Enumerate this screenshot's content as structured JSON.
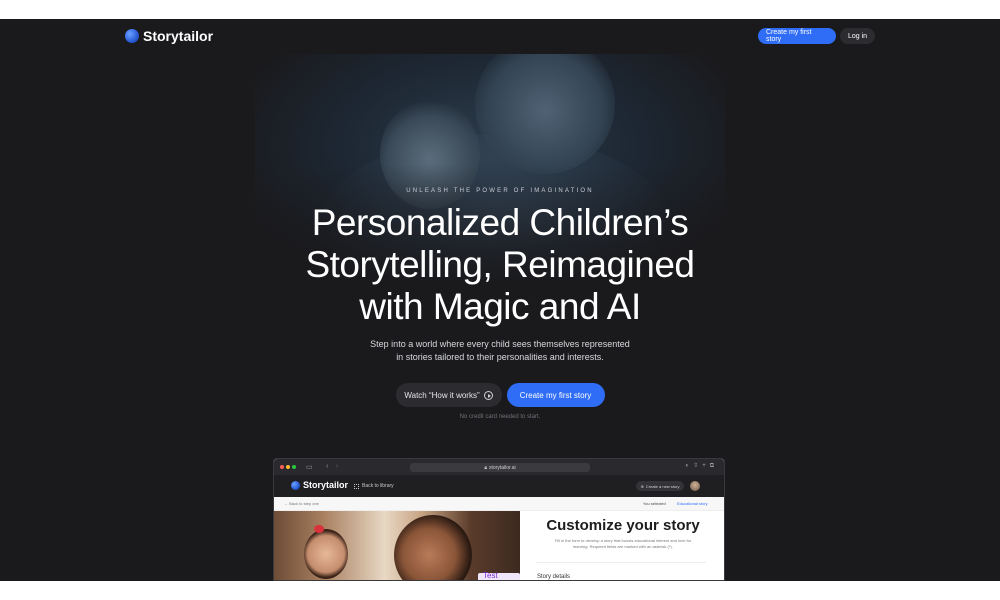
{
  "brand": {
    "name": "Storytailor"
  },
  "nav": {
    "cta": "Create my first story",
    "login": "Log in"
  },
  "hero": {
    "eyebrow": "UNLEASH THE POWER OF IMAGINATION",
    "headline_lines": [
      "Personalized Children’s",
      "Storytelling, Reimagined",
      "with Magic and AI"
    ],
    "subtitle_lines": [
      "Step into a world where every child sees themselves represented",
      "in stories tailored to their personalities and interests."
    ],
    "watch_label": "Watch “How it works”",
    "create_label": "Create my first story",
    "note": "No credit card needed to start."
  },
  "preview": {
    "url": "storytailor.ai",
    "app_name": "Storytailor",
    "back_to_library": "Back to library",
    "create_new": "Create a new story",
    "back_to_step": "← Back to step one",
    "you_selected": "You selected",
    "selected_type": "Educational story",
    "test_mode": "Test Mode",
    "form_title": "Customize your story",
    "form_desc": "Fill in the form to develop a story that boosts educational interest and love for learning. Required fields are marked with an asterisk (*).",
    "section": "Story details"
  },
  "colors": {
    "accent": "#2f6df6",
    "background": "#1a1a1d",
    "test_mode": "#7a2fd1"
  }
}
